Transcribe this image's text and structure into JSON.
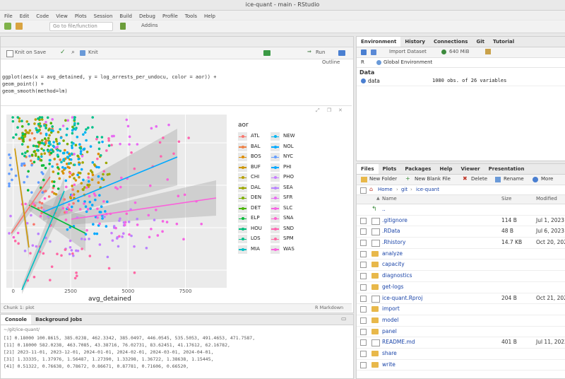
{
  "window": {
    "title": "ice-quant - main - RStudio"
  },
  "menu": [
    "File",
    "Edit",
    "Code",
    "View",
    "Plots",
    "Session",
    "Build",
    "Debug",
    "Profile",
    "Tools",
    "Help"
  ],
  "toolbar": {
    "goto_placeholder": "Go to file/function",
    "addins": "Addins"
  },
  "editor": {
    "save_label": "Knit on Save",
    "knit_label": "Knit",
    "run_label": "Run",
    "outline_label": "Outline",
    "code_lines": [
      "ggplot(aes(x = avg_detained, y = log_arrests_per_undocu, color = aor)) +",
      "  geom_point() +",
      "  geom_smooth(method=lm)"
    ],
    "status_left": "Chunk 1: plot",
    "status_right": "R Markdown"
  },
  "console": {
    "tabs": [
      "Console",
      "Background Jobs"
    ],
    "path": "~/git/ice-quant/",
    "lines": [
      "[1] 0.18000 100.8615, 385.0238, 462.3342, 385.0497, 446.0545, 535.5053, 491.4653, 471.7587,",
      "[11] 0.18000 582.0238, 463.7085, 43.38716, 76.02731, 83.62451, 41.17612, 62.16782,",
      "[21] 2023-11-01, 2023-12-01, 2024-01-01, 2024-02-01, 2024-03-01, 2024-04-01,",
      "[31] 1.33335, 1.37976, 1.56487, 1.27390, 1.33298, 1.36722, 1.38638, 1.15445,",
      "[41] 0.51322, 0.76638, 0.78672, 0.86671, 0.87781, 0.71606, 0.66520,"
    ]
  },
  "plot": {
    "legend_title": "aor",
    "legend_items": [
      {
        "label": "ATL",
        "color": "#f8766d"
      },
      {
        "label": "BAL",
        "color": "#ee8044"
      },
      {
        "label": "BOS",
        "color": "#de8c00"
      },
      {
        "label": "BUF",
        "color": "#cd9600"
      },
      {
        "label": "CHI",
        "color": "#b79f00"
      },
      {
        "label": "DAL",
        "color": "#9da700"
      },
      {
        "label": "DEN",
        "color": "#7cae00"
      },
      {
        "label": "DET",
        "color": "#49b500"
      },
      {
        "label": "ELP",
        "color": "#00ba38"
      },
      {
        "label": "HOU",
        "color": "#00bf7d"
      },
      {
        "label": "LOS",
        "color": "#00c08b"
      },
      {
        "label": "MIA",
        "color": "#00bfc4"
      },
      {
        "label": "NEW",
        "color": "#00b4f0"
      },
      {
        "label": "NOL",
        "color": "#00a9ff"
      },
      {
        "label": "NYC",
        "color": "#619cff"
      },
      {
        "label": "PHI",
        "color": "#00a9ff"
      },
      {
        "label": "PHO",
        "color": "#c77cff"
      },
      {
        "label": "SEA",
        "color": "#b983ff"
      },
      {
        "label": "SFR",
        "color": "#e76bf3"
      },
      {
        "label": "SLC",
        "color": "#f564e3"
      },
      {
        "label": "SNA",
        "color": "#fd61d1"
      },
      {
        "label": "SND",
        "color": "#ff64b0"
      },
      {
        "label": "SPM",
        "color": "#ff67a4"
      },
      {
        "label": "WAS",
        "color": "#fa62db"
      }
    ],
    "xlabel": "avg_detained",
    "xticks": [
      "0",
      "2500",
      "5000",
      "7500"
    ]
  },
  "environment": {
    "tabs": [
      "Environment",
      "History",
      "Connections",
      "Git",
      "Tutorial"
    ],
    "import_label": "Import Dataset",
    "memory_label": "640 MiB",
    "lang_label": "R",
    "scope_label": "Global Environment",
    "section": "Data",
    "objects": [
      {
        "name": "data",
        "value": "1080 obs. of 26 variables"
      }
    ]
  },
  "files": {
    "tabs": [
      "Files",
      "Plots",
      "Packages",
      "Help",
      "Viewer",
      "Presentation"
    ],
    "new_folder": "New Folder",
    "new_blank": "New Blank File",
    "delete": "Delete",
    "rename": "Rename",
    "more": "More",
    "breadcrumb": [
      "Home",
      "git",
      "ice-quant"
    ],
    "header": {
      "name": "Name",
      "size": "Size",
      "modified": "Modified"
    },
    "items": [
      {
        "name": "..",
        "type": "up",
        "size": "",
        "modified": ""
      },
      {
        "name": ".gitignore",
        "type": "file",
        "size": "114 B",
        "modified": "Jul 1, 2023"
      },
      {
        "name": ".RData",
        "type": "file",
        "size": "48 B",
        "modified": "Jul 6, 2023"
      },
      {
        "name": ".Rhistory",
        "type": "file",
        "size": "14.7 KB",
        "modified": "Oct 20, 2023"
      },
      {
        "name": "analyze",
        "type": "folder",
        "size": "",
        "modified": ""
      },
      {
        "name": "capacity",
        "type": "folder",
        "size": "",
        "modified": ""
      },
      {
        "name": "diagnostics",
        "type": "folder",
        "size": "",
        "modified": ""
      },
      {
        "name": "get-logs",
        "type": "folder",
        "size": "",
        "modified": ""
      },
      {
        "name": "ice-quant.Rproj",
        "type": "file",
        "size": "204 B",
        "modified": "Oct 21, 2023"
      },
      {
        "name": "import",
        "type": "folder",
        "size": "",
        "modified": ""
      },
      {
        "name": "model",
        "type": "folder",
        "size": "",
        "modified": ""
      },
      {
        "name": "panel",
        "type": "folder",
        "size": "",
        "modified": ""
      },
      {
        "name": "README.md",
        "type": "file",
        "size": "401 B",
        "modified": "Jul 11, 2023"
      },
      {
        "name": "share",
        "type": "folder",
        "size": "",
        "modified": ""
      },
      {
        "name": "write",
        "type": "folder",
        "size": "",
        "modified": ""
      }
    ]
  }
}
